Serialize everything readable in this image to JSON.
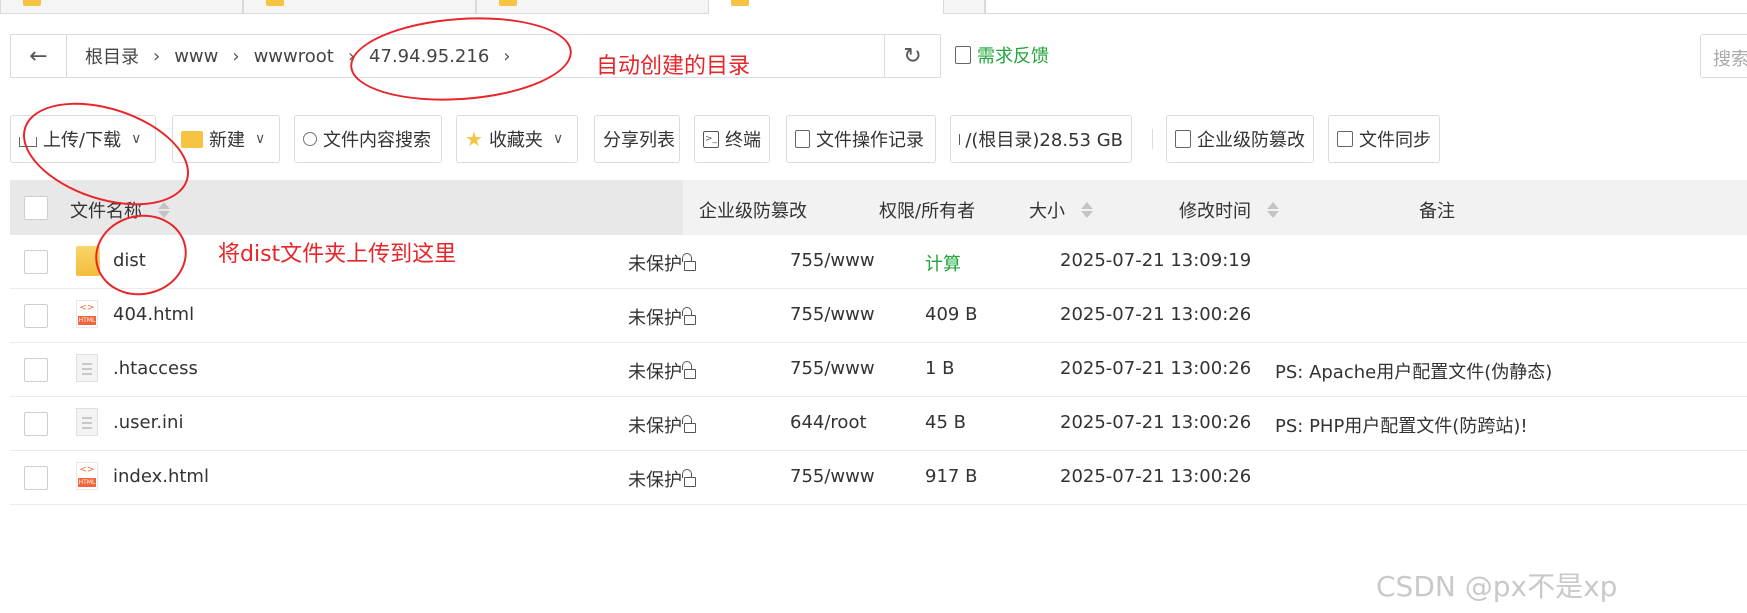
{
  "breadcrumb": [
    "根目录",
    "www",
    "wwwroot",
    "47.94.95.216"
  ],
  "feedback_label": "需求反馈",
  "search_placeholder": "搜索",
  "annotations": {
    "auto_dir": "自动创建的目录",
    "upload_here": "将dist文件夹上传到这里"
  },
  "toolbar": {
    "upload": "上传/下载",
    "new": "新建",
    "content_search": "文件内容搜索",
    "favorites": "收藏夹",
    "share_list": "分享列表",
    "terminal": "终端",
    "op_log": "文件操作记录",
    "disk": "/(根目录)28.53 GB",
    "tamper": "企业级防篡改",
    "sync": "文件同步"
  },
  "table": {
    "headers": {
      "name": "文件名称",
      "protect": "企业级防篡改",
      "perm": "权限/所有者",
      "size": "大小",
      "mtime": "修改时间",
      "note": "备注"
    },
    "rows": [
      {
        "name": "dist",
        "icon": "folder-icon",
        "protect": "未保护",
        "perm": "755/www",
        "size": "计算",
        "mtime": "2025-07-21 13:09:19",
        "note": ""
      },
      {
        "name": "404.html",
        "icon": "html-file-icon",
        "protect": "未保护",
        "perm": "755/www",
        "size": "409 B",
        "mtime": "2025-07-21 13:00:26",
        "note": ""
      },
      {
        "name": ".htaccess",
        "icon": "text-file-icon",
        "protect": "未保护",
        "perm": "755/www",
        "size": "1 B",
        "mtime": "2025-07-21 13:00:26",
        "note": "PS: Apache用户配置文件(伪静态)"
      },
      {
        "name": ".user.ini",
        "icon": "text-file-icon",
        "protect": "未保护",
        "perm": "644/root",
        "size": "45 B",
        "mtime": "2025-07-21 13:00:26",
        "note": "PS: PHP用户配置文件(防跨站)!"
      },
      {
        "name": "index.html",
        "icon": "html-file-icon",
        "protect": "未保护",
        "perm": "755/www",
        "size": "917 B",
        "mtime": "2025-07-21 13:00:26",
        "note": ""
      }
    ]
  },
  "watermark": "CSDN @px不是xp",
  "colors": {
    "accent_green": "#20a53a",
    "annotation_red": "#e8252a"
  }
}
